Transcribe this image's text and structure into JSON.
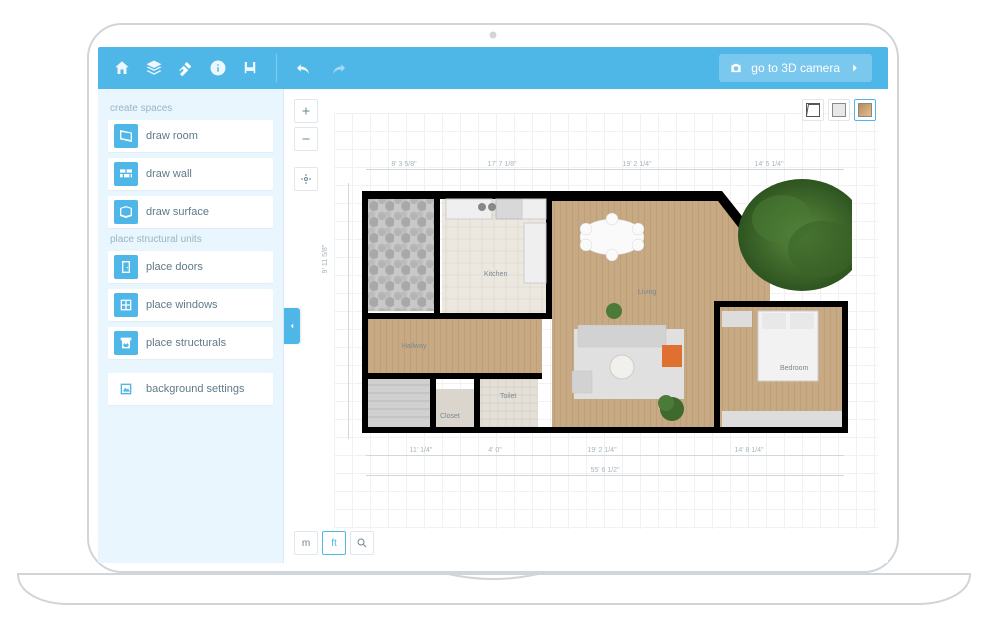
{
  "topbar": {
    "camera_button": "go to 3D camera",
    "nav_icons": [
      "home-icon",
      "layers-icon",
      "hammer-icon",
      "info-icon",
      "chair-icon"
    ]
  },
  "sidebar": {
    "sections": [
      {
        "header": "create spaces",
        "items": [
          {
            "icon": "draw-room-icon",
            "label": "draw room"
          },
          {
            "icon": "draw-wall-icon",
            "label": "draw wall"
          },
          {
            "icon": "draw-surface-icon",
            "label": "draw surface"
          }
        ]
      },
      {
        "header": "place structural units",
        "items": [
          {
            "icon": "door-icon",
            "label": "place doors"
          },
          {
            "icon": "window-icon",
            "label": "place windows"
          },
          {
            "icon": "fireplace-icon",
            "label": "place structurals"
          }
        ]
      },
      {
        "header": "",
        "items": [
          {
            "icon": "background-settings-icon",
            "label": "background settings"
          }
        ]
      }
    ]
  },
  "canvas": {
    "units": {
      "m": "m",
      "ft": "ft",
      "active": "ft"
    },
    "dimensions": {
      "top": [
        "8' 3 5/8\"",
        "17' 7 1/8\"",
        "19' 2 1/4\"",
        "14' 5 1/4\""
      ],
      "bottom_inner": [
        "11' 1/4\"",
        "4' 0\"",
        "19' 2 1/4\"",
        "14' 8 1/4\""
      ],
      "bottom_total": "55' 6 1/2\"",
      "left": "9' 11 5/8\""
    },
    "rooms": {
      "kitchen": "Kitchen",
      "living": "Living",
      "hallway": "Hallway",
      "toilet": "Toilet",
      "closet": "Closet",
      "bedroom": "Bedroom"
    },
    "view_modes": [
      "outline",
      "shaded",
      "textured"
    ],
    "active_view_mode": "textured"
  }
}
